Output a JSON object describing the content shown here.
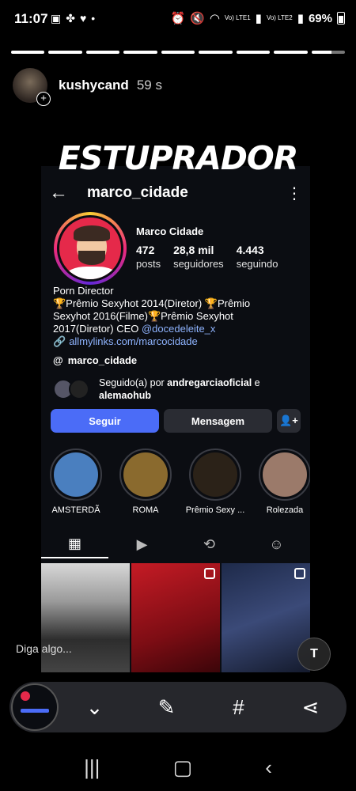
{
  "status_bar": {
    "time": "11:07",
    "battery": "69%",
    "sim1": "Vo) LTE1",
    "sim2": "Vo) LTE2"
  },
  "story": {
    "username": "kushycand",
    "time_ago": "59 s",
    "overlay_text": "ESTUPRADOR",
    "reply_placeholder": "Diga algo..."
  },
  "profile": {
    "username": "marco_cidade",
    "display_name": "Marco Cidade",
    "stats": [
      {
        "value": "472",
        "label": "posts"
      },
      {
        "value": "28,8 mil",
        "label": "seguidores"
      },
      {
        "value": "4.443",
        "label": "seguindo"
      }
    ],
    "bio_line1": "Porn Director",
    "bio_line2": "🏆Prêmio Sexyhot 2014(Diretor) 🏆Prêmio",
    "bio_line3": "Sexyhot 2016(Filme)🏆Prêmio Sexyhot",
    "bio_line4": "2017(Diretor)   CEO ",
    "bio_mention": "@docedeleite_x",
    "link": "allmylinks.com/marcocidade",
    "threads": "marco_cidade",
    "followed_prefix": "Seguido(a) por ",
    "followed_user1": "andregarciaoficial",
    "followed_mid": " e ",
    "followed_user2": "alemaohub",
    "follow_label": "Seguir",
    "message_label": "Mensagem",
    "highlights": [
      {
        "label": "AMSTERDÃ",
        "color": "#4a7fbf"
      },
      {
        "label": "ROMA",
        "color": "#8a6a2e"
      },
      {
        "label": "Prêmio Sexy ...",
        "color": "#2b2218"
      },
      {
        "label": "Rolezada",
        "color": "#9b7a6a"
      }
    ]
  },
  "icons": {
    "grid": "▦",
    "reels": "▶",
    "reposts": "⟲",
    "tagged": "☺",
    "text_tool": "T",
    "scan": "⌄",
    "edit": "✎",
    "hashtag": "#",
    "share": "⋖"
  }
}
